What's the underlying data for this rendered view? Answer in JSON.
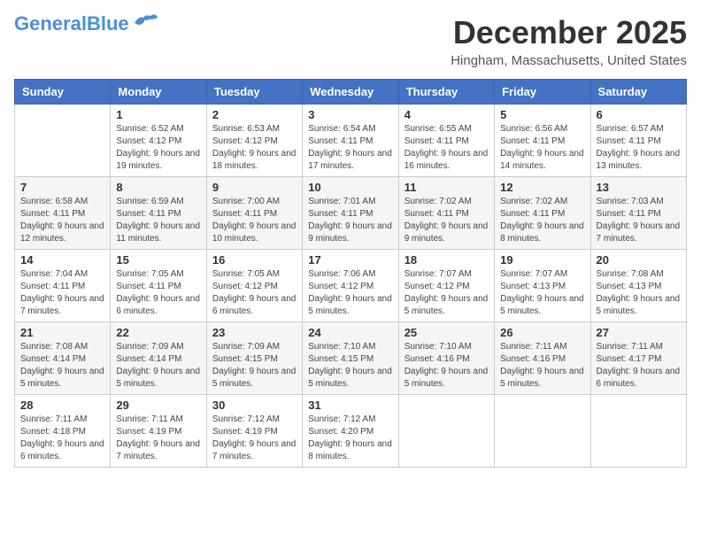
{
  "header": {
    "logo_general": "General",
    "logo_blue": "Blue",
    "month": "December 2025",
    "location": "Hingham, Massachusetts, United States"
  },
  "days_of_week": [
    "Sunday",
    "Monday",
    "Tuesday",
    "Wednesday",
    "Thursday",
    "Friday",
    "Saturday"
  ],
  "weeks": [
    [
      {
        "day": "",
        "sunrise": "",
        "sunset": "",
        "daylight": ""
      },
      {
        "day": "1",
        "sunrise": "Sunrise: 6:52 AM",
        "sunset": "Sunset: 4:12 PM",
        "daylight": "Daylight: 9 hours and 19 minutes."
      },
      {
        "day": "2",
        "sunrise": "Sunrise: 6:53 AM",
        "sunset": "Sunset: 4:12 PM",
        "daylight": "Daylight: 9 hours and 18 minutes."
      },
      {
        "day": "3",
        "sunrise": "Sunrise: 6:54 AM",
        "sunset": "Sunset: 4:11 PM",
        "daylight": "Daylight: 9 hours and 17 minutes."
      },
      {
        "day": "4",
        "sunrise": "Sunrise: 6:55 AM",
        "sunset": "Sunset: 4:11 PM",
        "daylight": "Daylight: 9 hours and 16 minutes."
      },
      {
        "day": "5",
        "sunrise": "Sunrise: 6:56 AM",
        "sunset": "Sunset: 4:11 PM",
        "daylight": "Daylight: 9 hours and 14 minutes."
      },
      {
        "day": "6",
        "sunrise": "Sunrise: 6:57 AM",
        "sunset": "Sunset: 4:11 PM",
        "daylight": "Daylight: 9 hours and 13 minutes."
      }
    ],
    [
      {
        "day": "7",
        "sunrise": "Sunrise: 6:58 AM",
        "sunset": "Sunset: 4:11 PM",
        "daylight": "Daylight: 9 hours and 12 minutes."
      },
      {
        "day": "8",
        "sunrise": "Sunrise: 6:59 AM",
        "sunset": "Sunset: 4:11 PM",
        "daylight": "Daylight: 9 hours and 11 minutes."
      },
      {
        "day": "9",
        "sunrise": "Sunrise: 7:00 AM",
        "sunset": "Sunset: 4:11 PM",
        "daylight": "Daylight: 9 hours and 10 minutes."
      },
      {
        "day": "10",
        "sunrise": "Sunrise: 7:01 AM",
        "sunset": "Sunset: 4:11 PM",
        "daylight": "Daylight: 9 hours and 9 minutes."
      },
      {
        "day": "11",
        "sunrise": "Sunrise: 7:02 AM",
        "sunset": "Sunset: 4:11 PM",
        "daylight": "Daylight: 9 hours and 9 minutes."
      },
      {
        "day": "12",
        "sunrise": "Sunrise: 7:02 AM",
        "sunset": "Sunset: 4:11 PM",
        "daylight": "Daylight: 9 hours and 8 minutes."
      },
      {
        "day": "13",
        "sunrise": "Sunrise: 7:03 AM",
        "sunset": "Sunset: 4:11 PM",
        "daylight": "Daylight: 9 hours and 7 minutes."
      }
    ],
    [
      {
        "day": "14",
        "sunrise": "Sunrise: 7:04 AM",
        "sunset": "Sunset: 4:11 PM",
        "daylight": "Daylight: 9 hours and 7 minutes."
      },
      {
        "day": "15",
        "sunrise": "Sunrise: 7:05 AM",
        "sunset": "Sunset: 4:11 PM",
        "daylight": "Daylight: 9 hours and 6 minutes."
      },
      {
        "day": "16",
        "sunrise": "Sunrise: 7:05 AM",
        "sunset": "Sunset: 4:12 PM",
        "daylight": "Daylight: 9 hours and 6 minutes."
      },
      {
        "day": "17",
        "sunrise": "Sunrise: 7:06 AM",
        "sunset": "Sunset: 4:12 PM",
        "daylight": "Daylight: 9 hours and 5 minutes."
      },
      {
        "day": "18",
        "sunrise": "Sunrise: 7:07 AM",
        "sunset": "Sunset: 4:12 PM",
        "daylight": "Daylight: 9 hours and 5 minutes."
      },
      {
        "day": "19",
        "sunrise": "Sunrise: 7:07 AM",
        "sunset": "Sunset: 4:13 PM",
        "daylight": "Daylight: 9 hours and 5 minutes."
      },
      {
        "day": "20",
        "sunrise": "Sunrise: 7:08 AM",
        "sunset": "Sunset: 4:13 PM",
        "daylight": "Daylight: 9 hours and 5 minutes."
      }
    ],
    [
      {
        "day": "21",
        "sunrise": "Sunrise: 7:08 AM",
        "sunset": "Sunset: 4:14 PM",
        "daylight": "Daylight: 9 hours and 5 minutes."
      },
      {
        "day": "22",
        "sunrise": "Sunrise: 7:09 AM",
        "sunset": "Sunset: 4:14 PM",
        "daylight": "Daylight: 9 hours and 5 minutes."
      },
      {
        "day": "23",
        "sunrise": "Sunrise: 7:09 AM",
        "sunset": "Sunset: 4:15 PM",
        "daylight": "Daylight: 9 hours and 5 minutes."
      },
      {
        "day": "24",
        "sunrise": "Sunrise: 7:10 AM",
        "sunset": "Sunset: 4:15 PM",
        "daylight": "Daylight: 9 hours and 5 minutes."
      },
      {
        "day": "25",
        "sunrise": "Sunrise: 7:10 AM",
        "sunset": "Sunset: 4:16 PM",
        "daylight": "Daylight: 9 hours and 5 minutes."
      },
      {
        "day": "26",
        "sunrise": "Sunrise: 7:11 AM",
        "sunset": "Sunset: 4:16 PM",
        "daylight": "Daylight: 9 hours and 5 minutes."
      },
      {
        "day": "27",
        "sunrise": "Sunrise: 7:11 AM",
        "sunset": "Sunset: 4:17 PM",
        "daylight": "Daylight: 9 hours and 6 minutes."
      }
    ],
    [
      {
        "day": "28",
        "sunrise": "Sunrise: 7:11 AM",
        "sunset": "Sunset: 4:18 PM",
        "daylight": "Daylight: 9 hours and 6 minutes."
      },
      {
        "day": "29",
        "sunrise": "Sunrise: 7:11 AM",
        "sunset": "Sunset: 4:19 PM",
        "daylight": "Daylight: 9 hours and 7 minutes."
      },
      {
        "day": "30",
        "sunrise": "Sunrise: 7:12 AM",
        "sunset": "Sunset: 4:19 PM",
        "daylight": "Daylight: 9 hours and 7 minutes."
      },
      {
        "day": "31",
        "sunrise": "Sunrise: 7:12 AM",
        "sunset": "Sunset: 4:20 PM",
        "daylight": "Daylight: 9 hours and 8 minutes."
      },
      {
        "day": "",
        "sunrise": "",
        "sunset": "",
        "daylight": ""
      },
      {
        "day": "",
        "sunrise": "",
        "sunset": "",
        "daylight": ""
      },
      {
        "day": "",
        "sunrise": "",
        "sunset": "",
        "daylight": ""
      }
    ]
  ]
}
